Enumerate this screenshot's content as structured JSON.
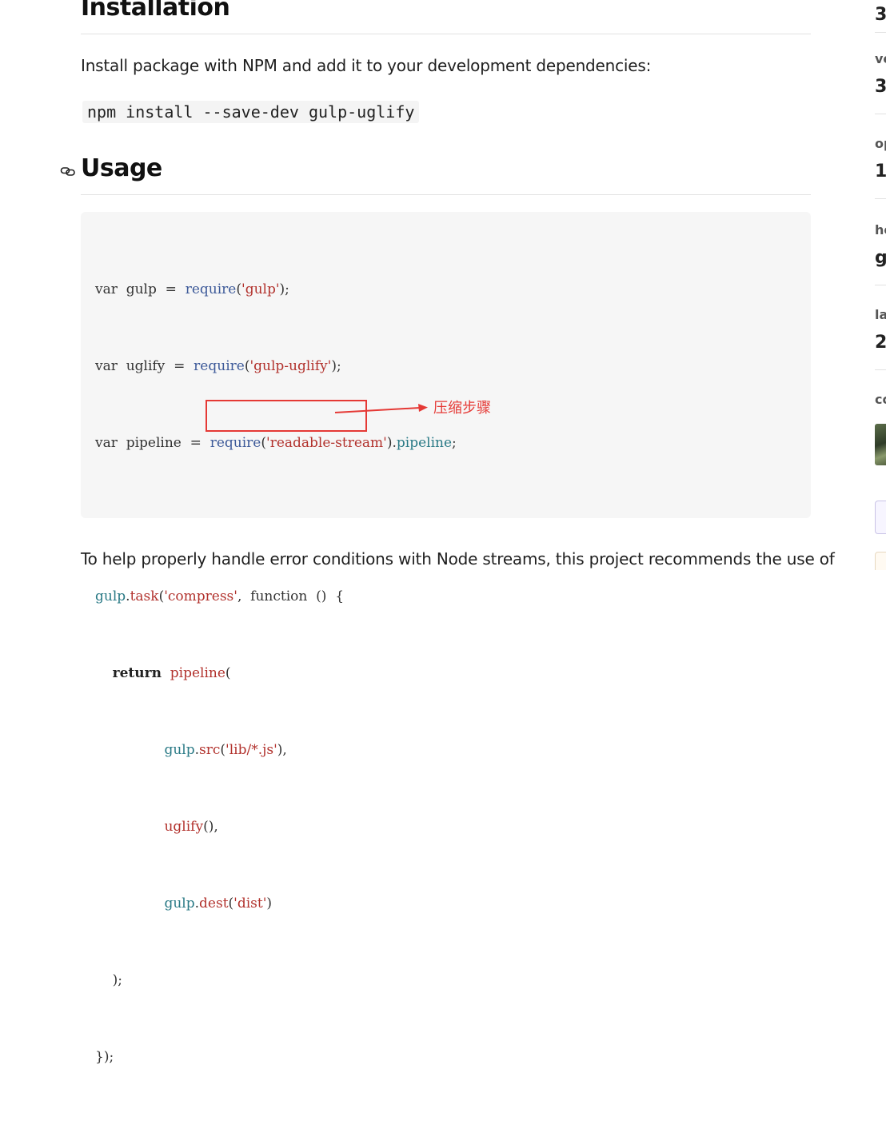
{
  "installation": {
    "heading": "Installation",
    "paragraph": "Install package with NPM and add it to your development dependencies:",
    "command": "npm install --save-dev gulp-uglify"
  },
  "usage": {
    "heading": "Usage",
    "anchor_icon": "link-icon",
    "code": {
      "l1": {
        "kw": "var",
        "name": "gulp",
        "eq": "=",
        "fn": "require",
        "open": "(",
        "str": "'gulp'",
        "close": ");"
      },
      "l2": {
        "kw": "var",
        "name": "uglify",
        "eq": "=",
        "fn": "require",
        "open": "(",
        "str": "'gulp-uglify'",
        "close": ");"
      },
      "l3": {
        "kw": "var",
        "name": "pipeline",
        "eq": "=",
        "fn": "require",
        "open": "(",
        "str": "'readable-stream'",
        "close": ").",
        "prop": "pipeline",
        "end": ";"
      },
      "l5": {
        "obj": "gulp",
        "dot": ".",
        "fn": "task",
        "open": "(",
        "str": "'compress'",
        "comma": ",",
        "kw": "function",
        "parens": "()",
        "brace": "{"
      },
      "l6": {
        "kw": "return",
        "fn": "pipeline",
        "open": "("
      },
      "l7": {
        "obj": "gulp",
        "dot": ".",
        "fn": "src",
        "open": "(",
        "str": "'lib/*.js'",
        "close": "),"
      },
      "l8": {
        "fn": "uglify",
        "close": "(),"
      },
      "l9": {
        "obj": "gulp",
        "dot": ".",
        "fn": "dest",
        "open": "(",
        "str": "'dist'",
        "close": ")"
      },
      "l10": {
        "close": ");"
      },
      "l11": {
        "close": "});"
      }
    },
    "annotation": {
      "label": "压缩步骤",
      "color": "#e53935"
    }
  },
  "after_paragraph": "To help properly handle error conditions with Node streams, this project recommends the use of",
  "sidebar": {
    "items": [
      {
        "label": "",
        "value": "3"
      },
      {
        "label": "ve",
        "value": "3"
      },
      {
        "label": "op",
        "value": "1"
      },
      {
        "label": "ho",
        "value": "g"
      },
      {
        "label": "la",
        "value": "2"
      },
      {
        "label": "co",
        "value": ""
      }
    ]
  },
  "colors": {
    "keyword": "#333333",
    "function": "#3d5a99",
    "string": "#b2322d",
    "identifier": "#2a7a86",
    "code_bg": "#f6f6f6"
  }
}
